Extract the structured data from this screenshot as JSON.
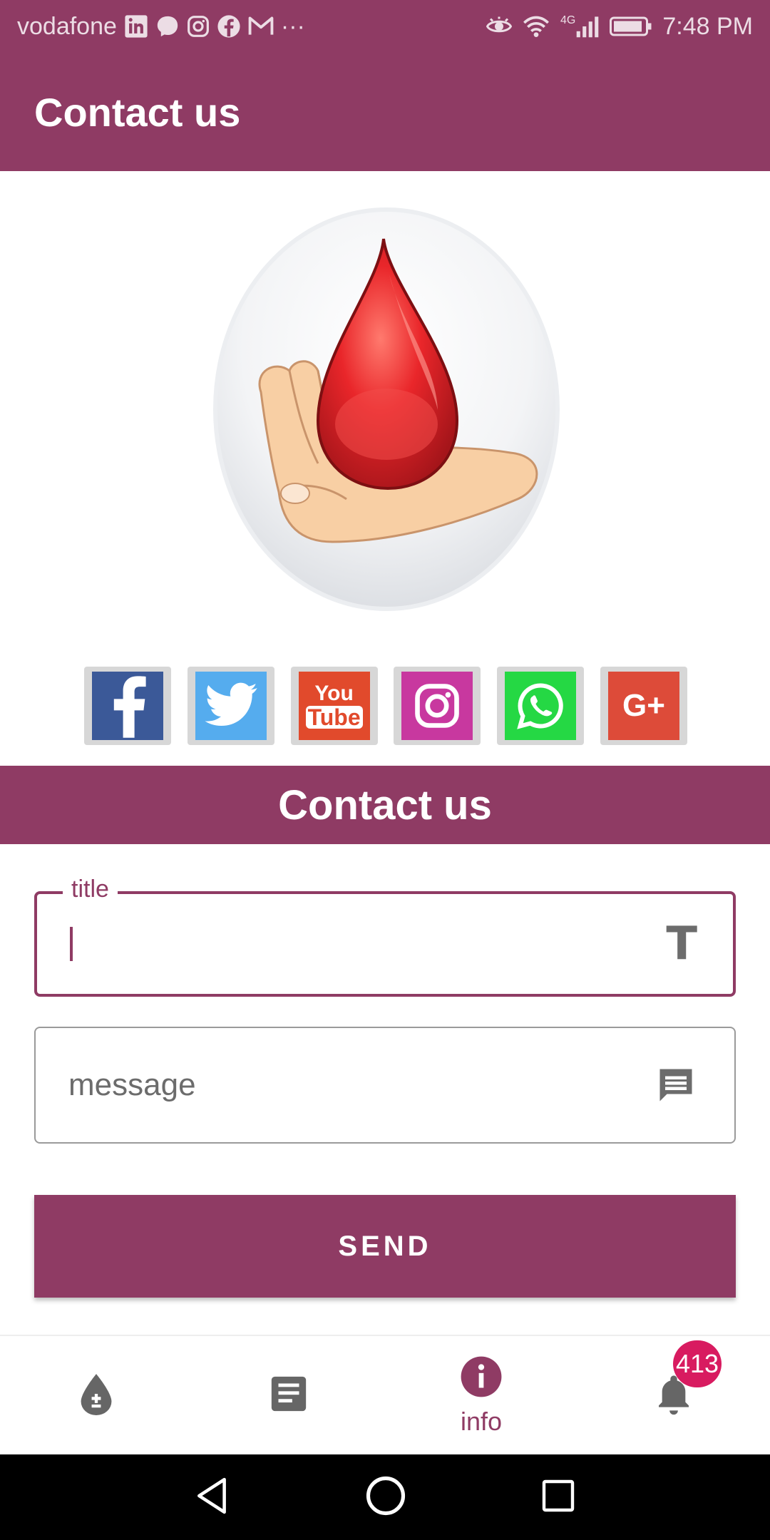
{
  "status_bar": {
    "carrier": "vodafone",
    "network": "4G",
    "time": "7:48 PM",
    "left_icons": [
      "linkedin-icon",
      "messenger-icon",
      "instagram-icon",
      "facebook-icon",
      "gmail-icon",
      "more-dots-icon"
    ],
    "right_icons": [
      "eye-icon",
      "wifi-icon",
      "signal-icon",
      "battery-icon"
    ],
    "more": "···"
  },
  "app_bar": {
    "title": "Contact us"
  },
  "logo": {
    "description_icon": "blood-drop-hand-logo"
  },
  "social": [
    {
      "name": "facebook",
      "icon": "facebook-icon",
      "color": "#3b5998"
    },
    {
      "name": "twitter",
      "icon": "twitter-icon",
      "color": "#55acee"
    },
    {
      "name": "youtube",
      "icon": "youtube-icon",
      "color": "#e14a2c",
      "top": "You",
      "bottom": "Tube"
    },
    {
      "name": "instagram",
      "icon": "instagram-icon",
      "color": "#c8389f"
    },
    {
      "name": "whatsapp",
      "icon": "whatsapp-icon",
      "color": "#25d844"
    },
    {
      "name": "google-plus",
      "icon": "google-plus-icon",
      "color": "#dd4b39",
      "text": "G+"
    }
  ],
  "section": {
    "title": "Contact us"
  },
  "form": {
    "title_label": "title",
    "title_value": "",
    "title_icon": "T",
    "message_placeholder": "message",
    "send_label": "SEND"
  },
  "bottom_nav": {
    "items": [
      {
        "name": "donate",
        "icon": "blood-drop-plus-minus-icon"
      },
      {
        "name": "articles",
        "icon": "article-icon"
      },
      {
        "name": "info",
        "icon": "info-icon",
        "label": "info",
        "active": true
      },
      {
        "name": "notifications",
        "icon": "bell-icon",
        "badge": "413"
      }
    ]
  },
  "colors": {
    "primary": "#8f3b64",
    "badge": "#d81b60"
  }
}
